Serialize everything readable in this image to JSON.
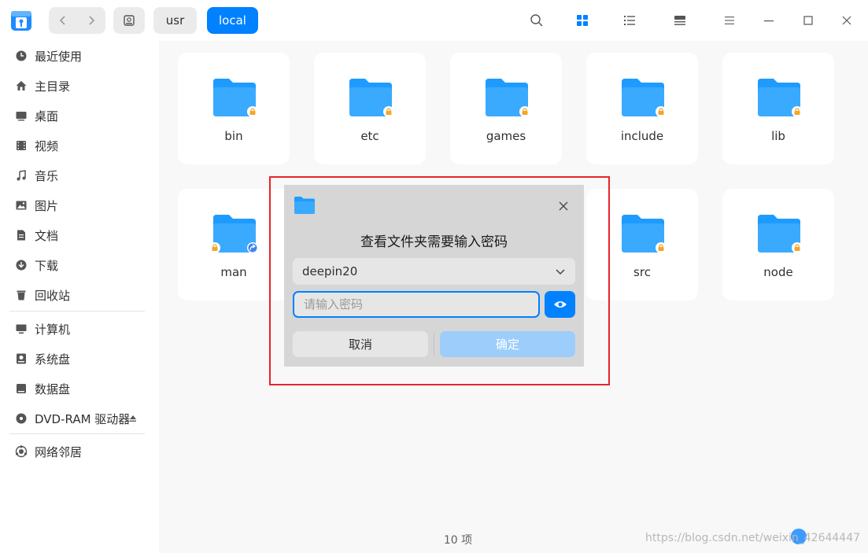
{
  "breadcrumb": {
    "usr": "usr",
    "local": "local"
  },
  "sidebar": {
    "items": [
      {
        "label": "最近使用",
        "icon": "clock-icon"
      },
      {
        "label": "主目录",
        "icon": "home-icon"
      },
      {
        "label": "桌面",
        "icon": "desktop-icon"
      },
      {
        "label": "视频",
        "icon": "video-icon"
      },
      {
        "label": "音乐",
        "icon": "music-icon"
      },
      {
        "label": "图片",
        "icon": "picture-icon"
      },
      {
        "label": "文档",
        "icon": "document-icon"
      },
      {
        "label": "下载",
        "icon": "download-icon"
      },
      {
        "label": "回收站",
        "icon": "trash-icon"
      }
    ],
    "devices": [
      {
        "label": "计算机",
        "icon": "computer-icon"
      },
      {
        "label": "系统盘",
        "icon": "system-disk-icon"
      },
      {
        "label": "数据盘",
        "icon": "data-disk-icon"
      },
      {
        "label": "DVD-RAM 驱动器",
        "icon": "dvd-icon"
      }
    ],
    "network": {
      "label": "网络邻居",
      "icon": "network-icon"
    }
  },
  "files": [
    {
      "name": "bin",
      "badge": "lock"
    },
    {
      "name": "etc",
      "badge": "lock"
    },
    {
      "name": "games",
      "badge": "lock"
    },
    {
      "name": "include",
      "badge": "lock"
    },
    {
      "name": "lib",
      "badge": "lock"
    },
    {
      "name": "man",
      "badge": "share"
    },
    {
      "name": "src",
      "badge": "lock"
    },
    {
      "name": "node",
      "badge": "lock"
    }
  ],
  "status": {
    "count": "10 项"
  },
  "watermark": "https://blog.csdn.net/weixin_42644447",
  "dialog": {
    "title": "查看文件夹需要输入密码",
    "user": "deepin20",
    "password_placeholder": "请输入密码",
    "cancel": "取消",
    "confirm": "确定"
  },
  "colors": {
    "accent": "#0081ff",
    "folder": "#1e9bff",
    "lock": "#f5a623",
    "highlight": "#e8232b"
  }
}
